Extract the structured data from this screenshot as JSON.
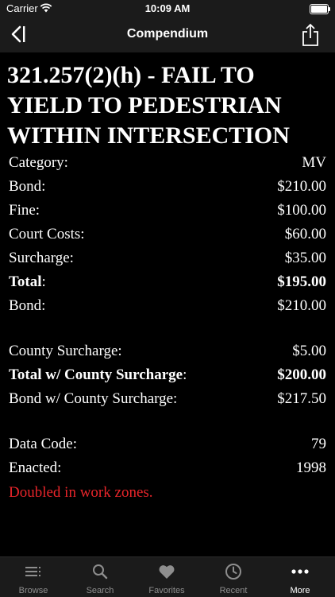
{
  "status_bar": {
    "carrier": "Carrier",
    "time": "10:09 AM"
  },
  "nav": {
    "title": "Compendium"
  },
  "violation": {
    "title": "321.257(2)(h) - FAIL TO YIELD TO PEDESTRIAN WITHIN INTERSECTION",
    "rows": [
      {
        "label": "Category:",
        "value": "MV",
        "bold": false
      },
      {
        "label": "Bond:",
        "value": "$210.00",
        "bold": false
      },
      {
        "label": "Fine:",
        "value": "$100.00",
        "bold": false
      },
      {
        "label": "Court Costs:",
        "value": "$60.00",
        "bold": false
      },
      {
        "label": "Surcharge:",
        "value": "$35.00",
        "bold": false
      },
      {
        "label": "Total",
        "label_suffix": ":",
        "value": "$195.00",
        "bold": true
      },
      {
        "label": "Bond:",
        "value": "$210.00",
        "bold": false
      },
      {
        "label": "County Surcharge:",
        "value": "$5.00",
        "bold": false
      },
      {
        "label": "Total w/ County Surcharge",
        "label_suffix": ":",
        "value": "$200.00",
        "bold": true
      },
      {
        "label": "Bond w/ County Surcharge:",
        "value": "$217.50",
        "bold": false
      },
      {
        "label": "Data Code:",
        "value": "79",
        "bold": false
      },
      {
        "label": "Enacted:",
        "value": "1998",
        "bold": false
      }
    ],
    "note": "Doubled in work zones.",
    "note_color": "#e8252a"
  },
  "tab_bar": {
    "tabs": [
      {
        "label": "Browse",
        "icon": "list-icon"
      },
      {
        "label": "Search",
        "icon": "search-icon"
      },
      {
        "label": "Favorites",
        "icon": "heart-icon"
      },
      {
        "label": "Recent",
        "icon": "clock-icon"
      },
      {
        "label": "More",
        "icon": "more-icon"
      }
    ],
    "active": "More"
  }
}
